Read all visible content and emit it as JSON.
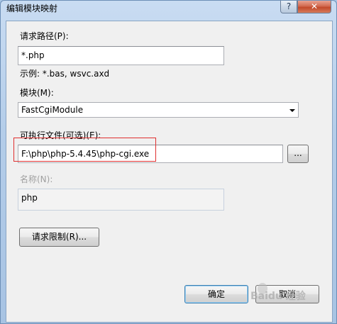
{
  "window": {
    "title": "编辑模块映射",
    "help_glyph": "?",
    "close_glyph": "✕"
  },
  "request_path": {
    "label": "请求路径(P):",
    "value": "*.php",
    "example": "示例: *.bas, wsvc.axd"
  },
  "module": {
    "label": "模块(M):",
    "selected": "FastCgiModule"
  },
  "executable": {
    "label": "可执行文件(可选)(E):",
    "value": "F:\\php\\php-5.4.45\\php-cgi.exe",
    "browse_label": "..."
  },
  "name": {
    "label": "名称(N):",
    "value": "php"
  },
  "restrictions_button": "请求限制(R)...",
  "ok_button": "确定",
  "cancel_button": "取消",
  "watermark": "Baidu 经验",
  "colors": {
    "highlight": "#e03030",
    "default_button_border": "#3c7fb1"
  }
}
